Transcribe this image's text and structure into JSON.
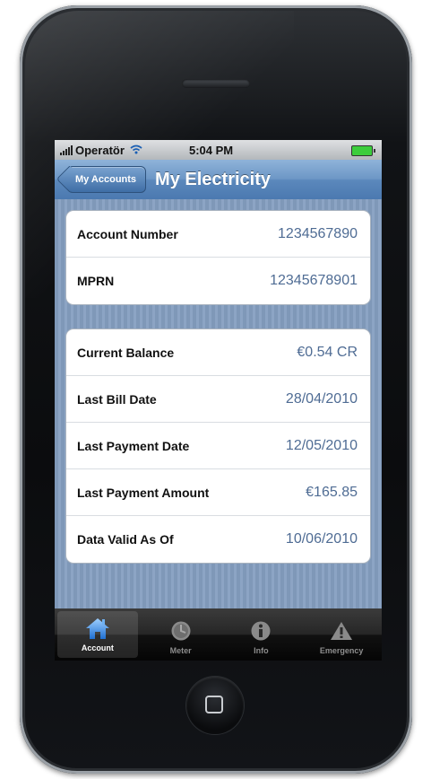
{
  "status_bar": {
    "carrier": "Operatör",
    "time": "5:04 PM"
  },
  "nav_bar": {
    "back_label": "My Accounts",
    "title": "My Electricity"
  },
  "account_group": {
    "rows": [
      {
        "label": "Account Number",
        "value": "1234567890"
      },
      {
        "label": "MPRN",
        "value": "12345678901"
      }
    ]
  },
  "details_group": {
    "rows": [
      {
        "label": "Current Balance",
        "value": "€0.54 CR"
      },
      {
        "label": "Last Bill Date",
        "value": "28/04/2010"
      },
      {
        "label": "Last Payment Date",
        "value": "12/05/2010"
      },
      {
        "label": "Last Payment Amount",
        "value": "€165.85"
      },
      {
        "label": "Data Valid As Of",
        "value": "10/06/2010"
      }
    ]
  },
  "tab_bar": {
    "tabs": [
      {
        "label": "Account",
        "icon": "home-icon",
        "active": true
      },
      {
        "label": "Meter",
        "icon": "clock-icon",
        "active": false
      },
      {
        "label": "Info",
        "icon": "info-icon",
        "active": false
      },
      {
        "label": "Emergency",
        "icon": "warning-icon",
        "active": false
      }
    ]
  },
  "colors": {
    "nav_bar": "#5b88bc",
    "value_text": "#4f6c94",
    "battery": "#3ccd3c",
    "wifi": "#1a5fb4"
  }
}
